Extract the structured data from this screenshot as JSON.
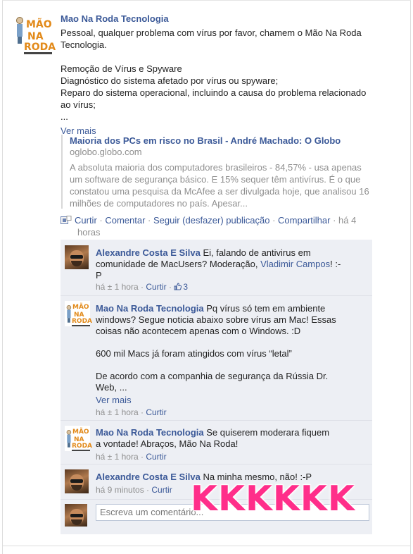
{
  "post": {
    "author": "Mao Na Roda Tecnologia",
    "logo_text": [
      "MÃO",
      "NA",
      "RODA"
    ],
    "lines": [
      "Pessoal, qualquer problema com vírus por favor, chamem o Mão Na Roda",
      "Tecnologia.",
      "",
      "Remoção de Vírus e Spyware",
      "Diagnóstico do sistema afetado por vírus ou spyware;",
      "Reparo do sistema operacional, incluindo a causa do problema relacionado",
      "ao vírus;",
      "..."
    ],
    "see_more": "Ver mais",
    "link": {
      "title": "Maioria dos PCs em risco no Brasil - André Machado: O Globo",
      "domain": "oglobo.globo.com",
      "lines": [
        "A absoluta maioria dos computadores brasileiros - 84,57% - usa apenas",
        "um software de segurança básico. E 15% sequer têm antivírus. É o que",
        "constatou uma pesquisa da McAfee a ser divulgada hoje, que analisou 16",
        "milhões de computadores no país. Apesar..."
      ]
    },
    "actions": {
      "like": "Curtir",
      "sep": " · ",
      "comment": "Comentar",
      "follow": "Seguir (desfazer) publicação",
      "share": "Compartilhar",
      "time_a": "há 4",
      "time_b": "horas"
    }
  },
  "comments": [
    {
      "author": "Alexandre Costa E Silva",
      "line1_rest": " Ei, falando de antivirus em",
      "line2_pre": "comunidade de MacUsers? Moderação, ",
      "mention": "Vladimir Campos",
      "line2_post": "! :-",
      "line3": "P",
      "time": "há ± 1 hora",
      "like": "Curtir",
      "likes_count": "3"
    },
    {
      "author": "Mao Na Roda Tecnologia",
      "line1_rest": " Pq vírus só tem em ambiente",
      "lines": [
        "windows? Segue noticia abaixo sobre vírus am Mac! Essas",
        "coisas não acontecem apenas com o Windows. :D",
        "",
        "600 mil Macs já foram atingidos com vírus “letal”",
        "",
        "De acordo com a companhia de segurança da Rússia Dr.",
        "Web, ..."
      ],
      "see_more": "Ver mais",
      "time": "há ± 1 hora",
      "like": "Curtir"
    },
    {
      "author": "Mao Na Roda Tecnologia",
      "line1_rest": " Se quiserem moderara fiquem",
      "line2": "a vontade! Abraços, Mão Na Roda!",
      "time": "há ± 1 hora",
      "like": "Curtir"
    },
    {
      "author": "Alexandre Costa E Silva",
      "line1_rest": " Na minha mesmo, não! :-P",
      "time": "há 9 minutos",
      "like": "Curtir"
    }
  ],
  "composer": {
    "placeholder": "Escreva um comentário..."
  },
  "overlay_text": "KKKKKK",
  "colors": {
    "link": "#3b5998",
    "comment_bg": "#edeff4",
    "overlay": "#ff2e8a",
    "logo_orange": "#e28a1a"
  }
}
